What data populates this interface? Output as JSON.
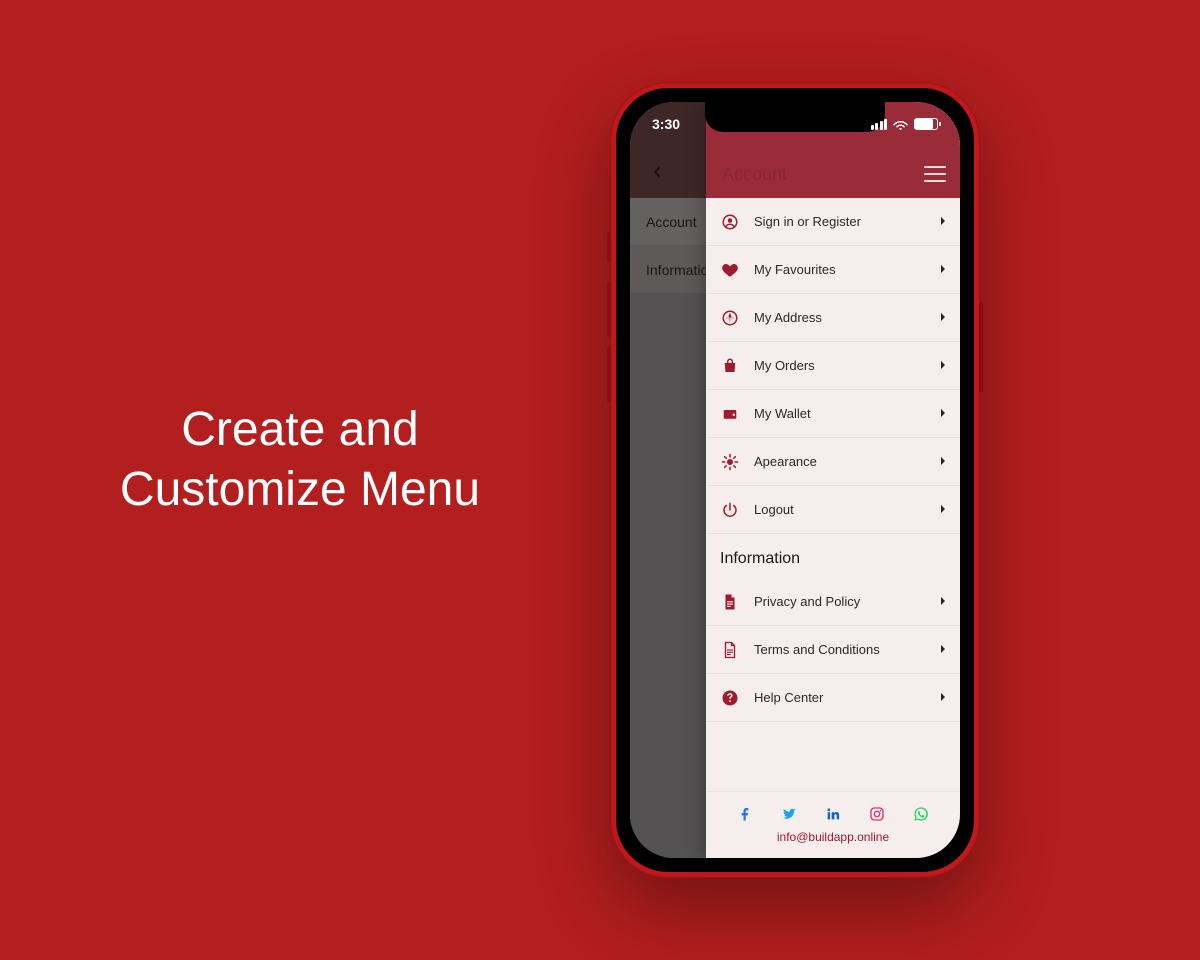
{
  "headline": {
    "line1": "Create and",
    "line2": "Customize Menu"
  },
  "statusbar": {
    "time": "3:30"
  },
  "page": {
    "tabs": [
      "Account",
      "Information"
    ]
  },
  "drawer": {
    "title": "Account",
    "account_items": [
      {
        "icon": "user-icon",
        "label": "Sign in or Register"
      },
      {
        "icon": "heart-icon",
        "label": "My Favourites"
      },
      {
        "icon": "compass-icon",
        "label": "My Address"
      },
      {
        "icon": "bag-icon",
        "label": "My Orders"
      },
      {
        "icon": "wallet-icon",
        "label": "My Wallet"
      },
      {
        "icon": "brightness-icon",
        "label": "Apearance"
      },
      {
        "icon": "power-icon",
        "label": "Logout"
      }
    ],
    "info_title": "Information",
    "info_items": [
      {
        "icon": "document-icon",
        "label": "Privacy and Policy"
      },
      {
        "icon": "document-line-icon",
        "label": "Terms and Conditions"
      },
      {
        "icon": "help-icon",
        "label": "Help Center"
      }
    ],
    "socials": [
      "facebook-icon",
      "twitter-icon",
      "linkedin-icon",
      "instagram-icon",
      "whatsapp-icon"
    ],
    "social_colors": {
      "facebook-icon": "#1877F2",
      "twitter-icon": "#1DA1F2",
      "linkedin-icon": "#0A66C2",
      "instagram-icon": "#E1306C",
      "whatsapp-icon": "#25D366"
    },
    "contact": "info@buildapp.online"
  },
  "colors": {
    "background": "#b31e1e",
    "accent": "#9e1c2d"
  }
}
